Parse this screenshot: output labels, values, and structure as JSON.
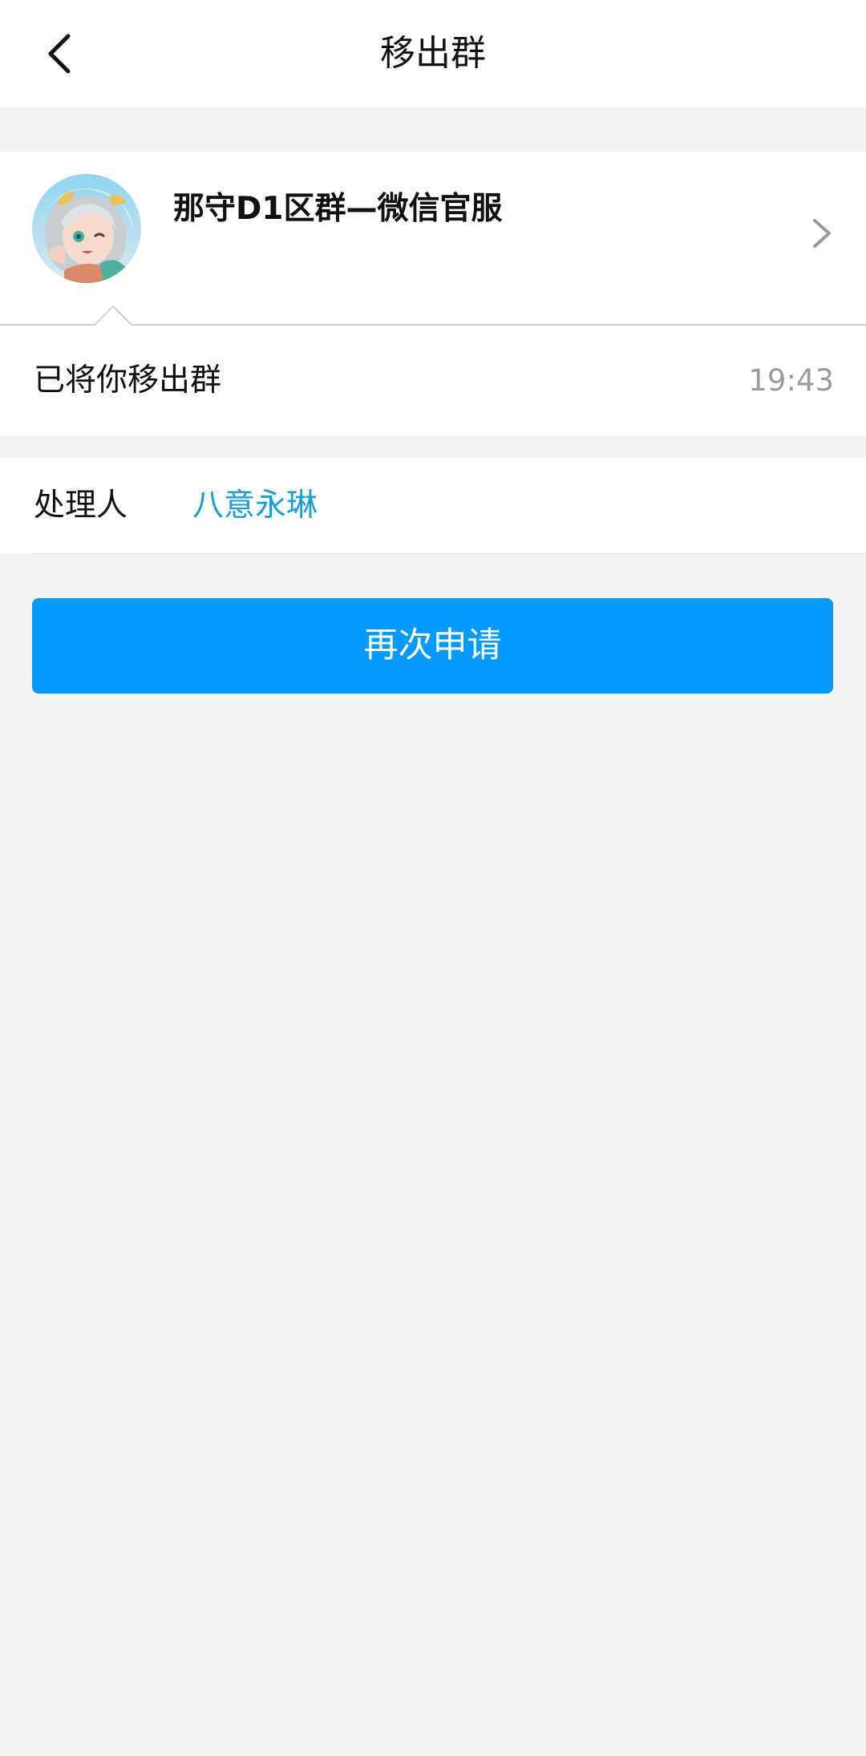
{
  "header": {
    "title": "移出群"
  },
  "group": {
    "name": "那守D1区群—微信官服"
  },
  "message": {
    "text": "已将你移出群",
    "time": "19:43"
  },
  "handler": {
    "label": "处理人",
    "name": "八意永琳"
  },
  "actions": {
    "reapply_label": "再次申请"
  },
  "colors": {
    "accent_button": "#0399fe",
    "handler_link": "#1a9ed8",
    "background": "#f3f3f3"
  },
  "icons": {
    "back": "chevron-left-icon",
    "forward": "chevron-right-icon"
  }
}
